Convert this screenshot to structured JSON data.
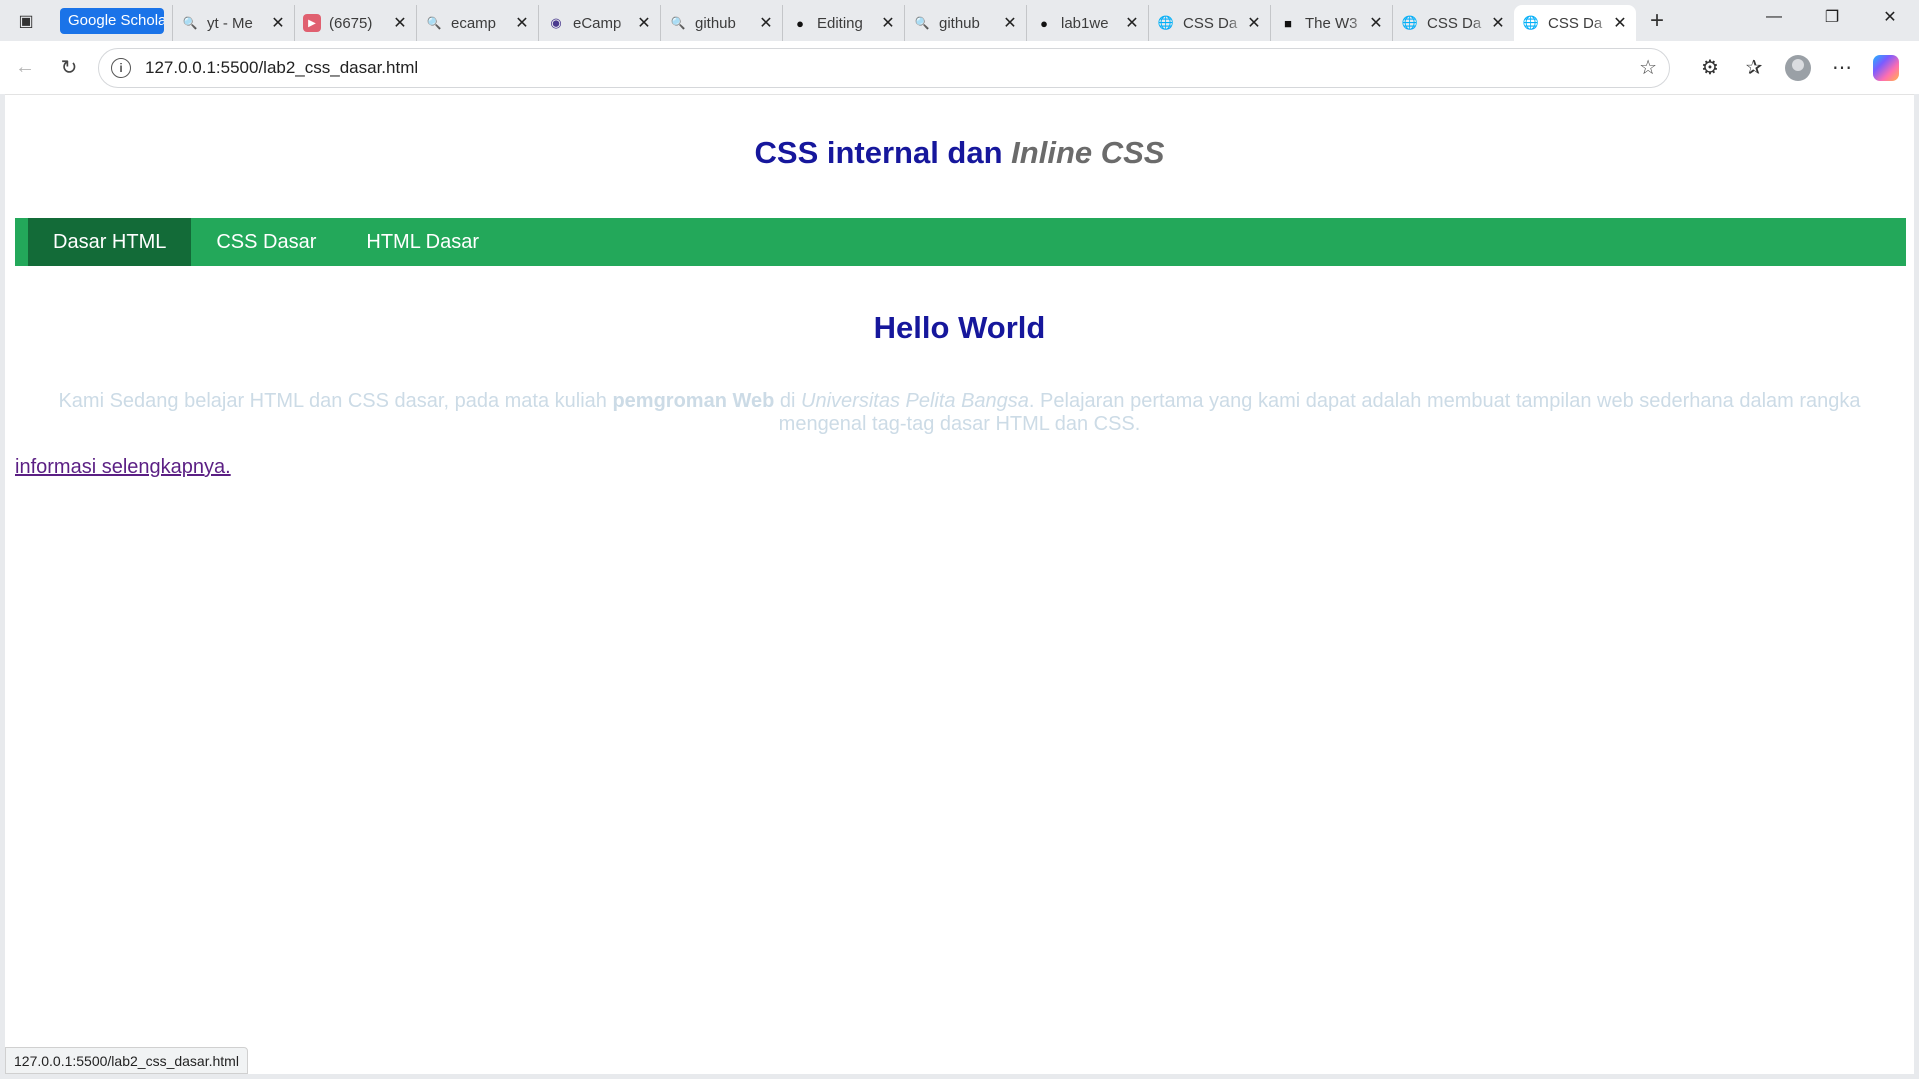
{
  "browser": {
    "pinned_tab": "Google Scholar",
    "tabs": [
      {
        "title": "yt - Me",
        "icon": "search-icon"
      },
      {
        "title": "(6675)",
        "icon": "youtube-icon"
      },
      {
        "title": "ecamp",
        "icon": "search-icon"
      },
      {
        "title": "eCamp",
        "icon": "ecampus-icon"
      },
      {
        "title": "github",
        "icon": "search-icon"
      },
      {
        "title": "Editing",
        "icon": "github-icon"
      },
      {
        "title": "github",
        "icon": "search-icon"
      },
      {
        "title": "lab1we",
        "icon": "github-icon"
      },
      {
        "title": "CSS Da",
        "icon": "globe-icon"
      },
      {
        "title": "The W3",
        "icon": "w3-icon"
      },
      {
        "title": "CSS Da",
        "icon": "globe-icon"
      },
      {
        "title": "CSS Da",
        "icon": "globe-icon",
        "active": true
      }
    ],
    "address": "127.0.0.1:5500/lab2_css_dasar.html",
    "status_url": "127.0.0.1:5500/lab2_css_dasar.html"
  },
  "page": {
    "heading_main": "CSS internal dan ",
    "heading_italic": "Inline CSS",
    "menu": [
      {
        "label": "Dasar HTML",
        "active": true
      },
      {
        "label": "CSS Dasar"
      },
      {
        "label": "HTML Dasar"
      }
    ],
    "hello": "Hello World",
    "para_1": "Kami Sedang belajar HTML dan CSS dasar, pada mata kuliah ",
    "para_bold": "pemgroman Web",
    "para_2": " di ",
    "para_italic": "Universitas Pelita Bangsa",
    "para_3": ". Pelajaran pertama yang kami dapat adalah membuat tampilan web sederhana dalam rangka mengenal tag-tag dasar HTML dan CSS.",
    "more_link": "informasi selengkapnya."
  },
  "colors": {
    "heading": "#16179c",
    "menu_bg": "#23a85a",
    "menu_active": "#136b38",
    "paragraph": "#ccdbe6",
    "link_visited": "#5b1f84"
  }
}
